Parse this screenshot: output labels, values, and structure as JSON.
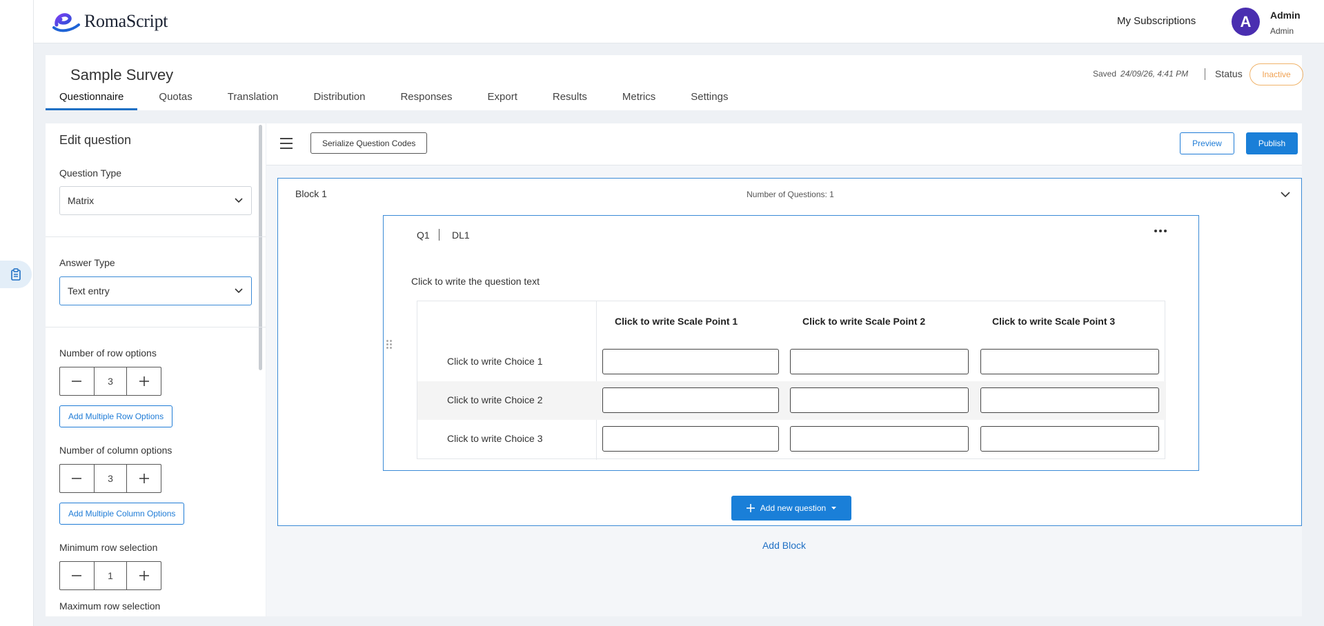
{
  "app": {
    "name": "RomaScript"
  },
  "header": {
    "subscriptions_label": "My Subscriptions",
    "user": {
      "initial": "A",
      "name": "Admin",
      "role": "Admin"
    }
  },
  "survey": {
    "title": "Sample Survey",
    "saved_label": "Saved",
    "saved_time": "24/09/26, 4:41 PM",
    "status_label": "Status",
    "status_value": "Inactive",
    "tabs": [
      {
        "label": "Questionnaire",
        "active": true
      },
      {
        "label": "Quotas"
      },
      {
        "label": "Translation"
      },
      {
        "label": "Distribution"
      },
      {
        "label": "Responses"
      },
      {
        "label": "Export"
      },
      {
        "label": "Results"
      },
      {
        "label": "Metrics"
      },
      {
        "label": "Settings"
      }
    ]
  },
  "edit_panel": {
    "title": "Edit question",
    "question_type_label": "Question Type",
    "question_type_value": "Matrix",
    "answer_type_label": "Answer Type",
    "answer_type_value": "Text entry",
    "row_options_label": "Number of row options",
    "row_options_value": "3",
    "add_rows_button": "Add Multiple Row Options",
    "column_options_label": "Number of column options",
    "column_options_value": "3",
    "add_columns_button": "Add Multiple Column Options",
    "min_row_label": "Minimum row selection",
    "min_row_value": "1",
    "max_row_label": "Maximum row selection"
  },
  "toolbar": {
    "serialize_button": "Serialize Question Codes",
    "preview_button": "Preview",
    "publish_button": "Publish"
  },
  "block": {
    "title": "Block 1",
    "count_text": "Number of Questions: 1",
    "question": {
      "id": "Q1",
      "label": "DL1",
      "text": "Click to write the question text",
      "columns": [
        "Click to write Scale Point 1",
        "Click to write Scale Point 2",
        "Click to write Scale Point 3"
      ],
      "rows": [
        "Click to write Choice 1",
        "Click to write Choice 2",
        "Click to write Choice 3"
      ]
    },
    "add_question_button": "Add new question",
    "add_block_link": "Add Block"
  },
  "colors": {
    "primary": "#1a7fd8",
    "avatar": "#4a2eb0",
    "status": "#f0a050"
  }
}
